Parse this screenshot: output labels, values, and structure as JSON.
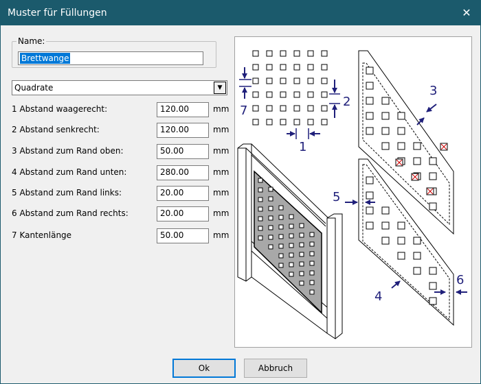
{
  "window": {
    "title": "Muster für Füllungen",
    "close_glyph": "✕"
  },
  "name": {
    "legend": "Name:",
    "value": "Brettwange"
  },
  "pattern": {
    "selected": "Quadrate",
    "arrow_glyph": "▼"
  },
  "fields": [
    {
      "label": "1 Abstand waagerecht:",
      "value": "120.00",
      "unit": "mm"
    },
    {
      "label": "2 Abstand senkrecht:",
      "value": "120.00",
      "unit": "mm"
    },
    {
      "label": "3 Abstand zum Rand oben:",
      "value": "50.00",
      "unit": "mm"
    },
    {
      "label": "4 Abstand zum Rand unten:",
      "value": "280.00",
      "unit": "mm"
    },
    {
      "label": "5 Abstand zum Rand links:",
      "value": "20.00",
      "unit": "mm"
    },
    {
      "label": "6 Abstand zum Rand rechts:",
      "value": "20.00",
      "unit": "mm"
    },
    {
      "label": "7 Kantenlänge",
      "value": "50.00",
      "unit": "mm"
    }
  ],
  "illustration": {
    "labels": {
      "n1": "1",
      "n2": "2",
      "n3": "3",
      "n4": "4",
      "n5": "5",
      "n6": "6",
      "n7": "7"
    },
    "colors": {
      "dimension": "#1f1f7a",
      "marker": "#cc0000",
      "panel_fill": "#a8a8a8"
    }
  },
  "buttons": {
    "ok": "Ok",
    "cancel": "Abbruch"
  },
  "colors": {
    "titlebar": "#1b5a6c",
    "selection": "#0078d7"
  }
}
